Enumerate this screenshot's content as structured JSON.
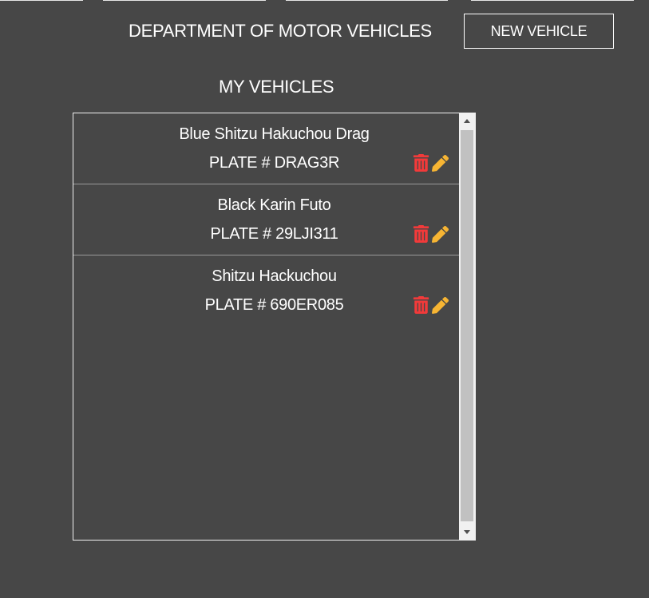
{
  "header": {
    "title": "DEPARTMENT OF MOTOR VEHICLES",
    "new_vehicle_label": "NEW VEHICLE"
  },
  "main": {
    "section_title": "MY VEHICLES",
    "plate_prefix": "PLATE #",
    "vehicles": [
      {
        "name": "Blue Shitzu Hakuchou Drag",
        "plate": "DRAG3R"
      },
      {
        "name": "Black Karin Futo",
        "plate": "29LJI311"
      },
      {
        "name": "Shitzu Hackuchou",
        "plate": "690ER085"
      }
    ]
  },
  "icons": {
    "delete": "trash-icon",
    "edit": "pencil-icon"
  },
  "colors": {
    "background": "#474747",
    "delete_icon": "#f23a3a",
    "edit_icon": "#f7b533",
    "scroll_thumb": "#c1c1c1"
  }
}
